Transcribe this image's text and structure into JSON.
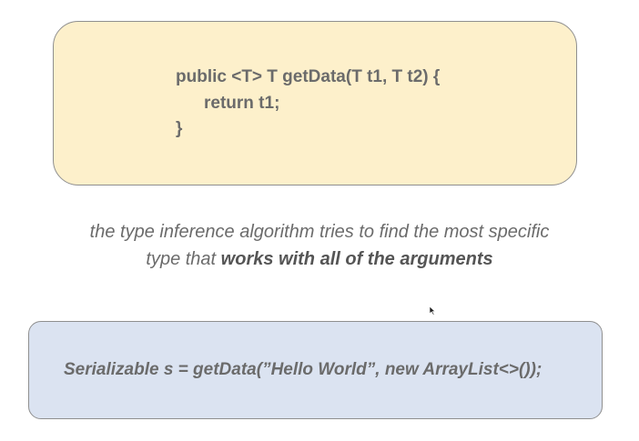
{
  "code_box": {
    "line1": "public <T> T getData(T t1, T t2) {",
    "line2": "return t1;",
    "line3": "}"
  },
  "caption": {
    "line1": "the type inference algorithm tries to find the most specific",
    "line2_prefix": "type that ",
    "line2_bold": "works with all of the arguments"
  },
  "example_box": {
    "code": "Serializable s = getData(”Hello World”, new ArrayList<>());"
  },
  "colors": {
    "code_box_bg": "#fdf0cb",
    "example_box_bg": "#dbe3f1",
    "text": "#6b6b6b"
  }
}
